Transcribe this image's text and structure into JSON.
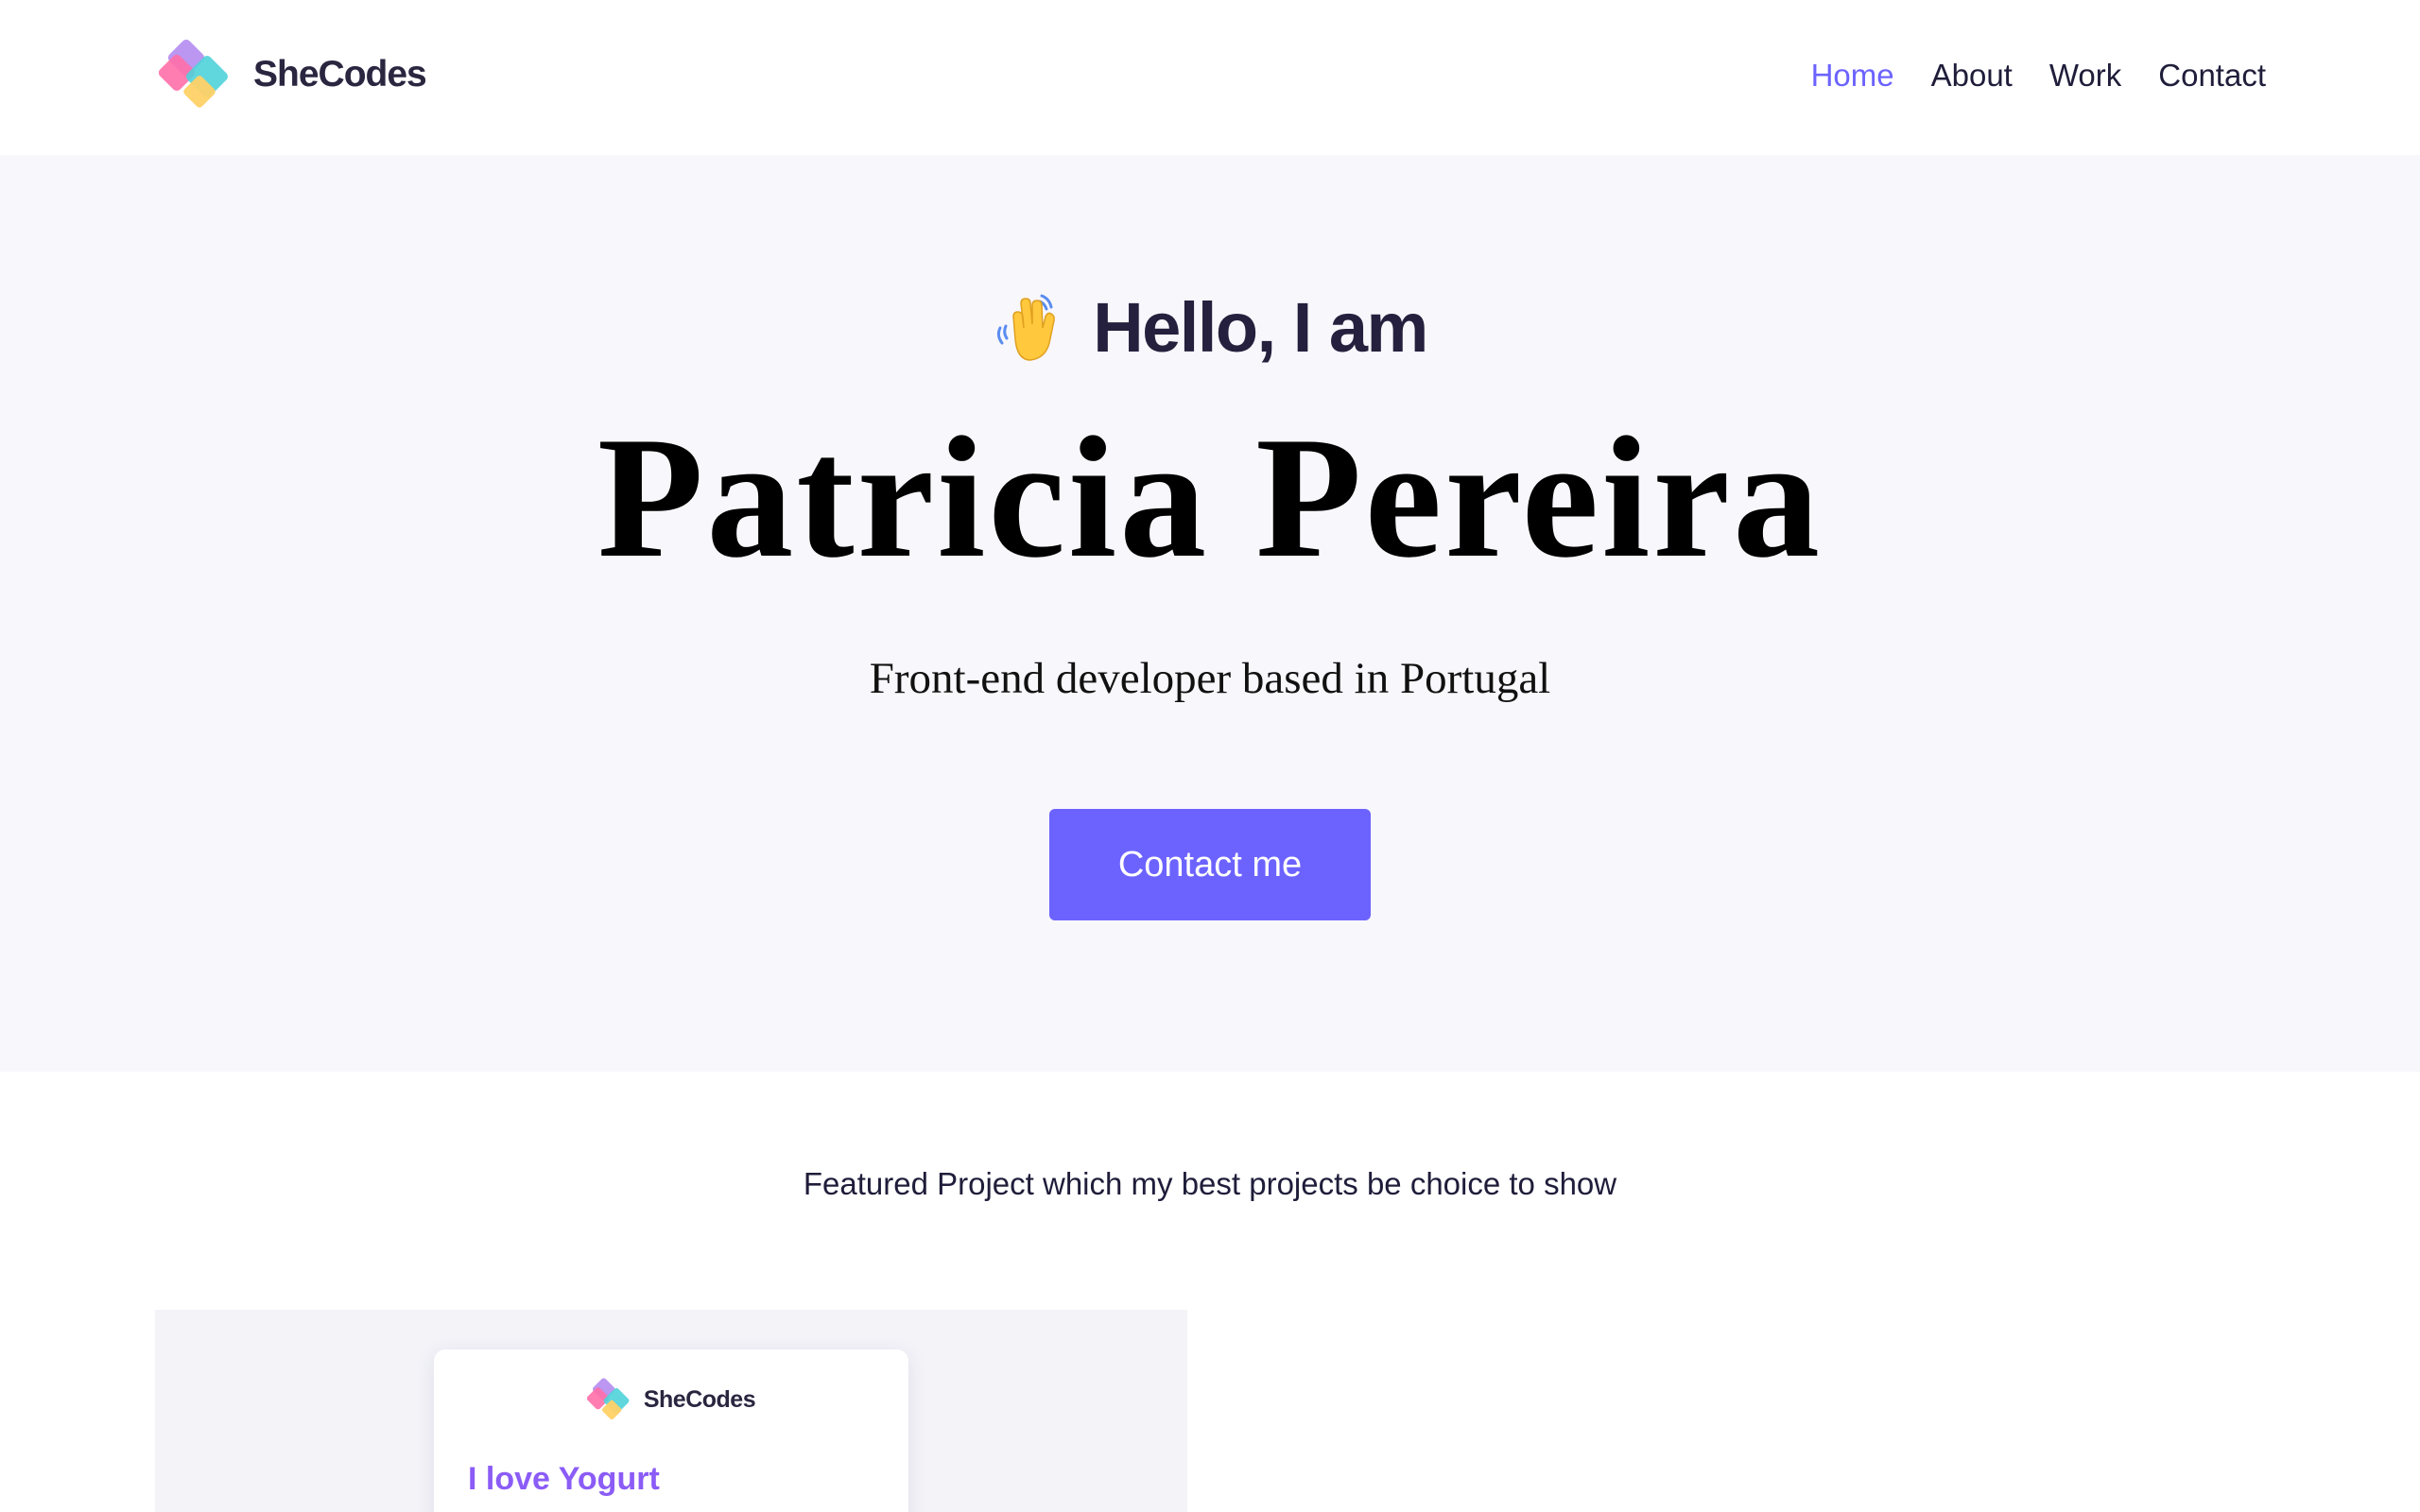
{
  "header": {
    "brand_name": "SheCodes",
    "brand_colors": [
      "#b48cf0",
      "#ff6fa8",
      "#4fd1d9",
      "#ffd166"
    ],
    "nav": [
      {
        "label": "Home",
        "active": true
      },
      {
        "label": "About",
        "active": false
      },
      {
        "label": "Work",
        "active": false
      },
      {
        "label": "Contact",
        "active": false
      }
    ]
  },
  "hero": {
    "greeting_icon": "waving-hand-icon",
    "greeting": "Hello, I am",
    "name": "Patricia Pereira",
    "subtitle": "Front-end developer based in Portugal",
    "cta_label": "Contact me"
  },
  "featured": {
    "intro": "Featured Project which my best projects be choice to show",
    "project": {
      "brand_name": "SheCodes",
      "title": "I love Yogurt"
    }
  },
  "colors": {
    "accent": "#6c63ff",
    "hero_background": "#f8f7fc",
    "project_title": "#8b5cf6",
    "text": "#1f1d3a"
  }
}
